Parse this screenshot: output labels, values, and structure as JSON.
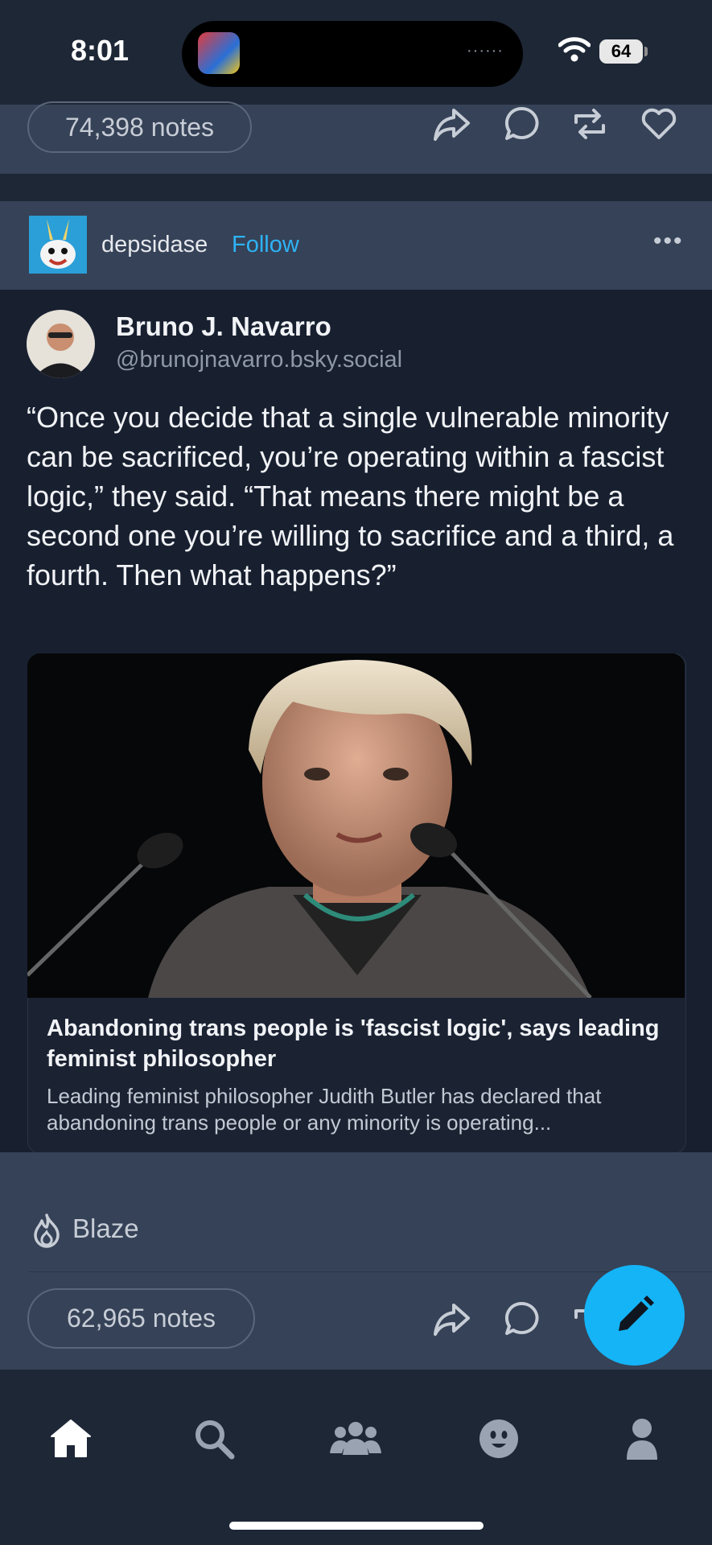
{
  "status_bar": {
    "time": "8:01",
    "battery": "64"
  },
  "previous_post": {
    "notes": "74,398 notes"
  },
  "post": {
    "blog_name": "depsidase",
    "follow_label": "Follow",
    "more_label": "•••",
    "embed": {
      "author_name": "Bruno J. Navarro",
      "author_handle": "@brunojnavarro.bsky.social",
      "text": "“Once you decide that a single vulnerable minority can be sacrificed, you’re operating within a fascist logic,” they said. “That means there might be a second one you’re willing to sacrifice and a third, a fourth. Then what happens?”",
      "link": {
        "title": "Abandoning trans people is 'fascist logic', says leading feminist philosopher",
        "description": "Leading feminist philosopher Judith Butler has declared that abandoning trans people or any minority is operating..."
      }
    },
    "blaze_label": "Blaze",
    "notes": "62,965 notes"
  },
  "icons": {
    "share": "share-icon",
    "comment": "comment-icon",
    "reblog": "reblog-icon",
    "like": "heart-icon",
    "blaze": "flame-icon",
    "compose": "pencil-icon",
    "tabs": [
      "home-icon",
      "search-icon",
      "community-icon",
      "activity-icon",
      "account-icon"
    ]
  },
  "colors": {
    "accent": "#2eb3f5",
    "fab": "#14b4f7",
    "background": "#1e2736",
    "panel": "#364257"
  }
}
